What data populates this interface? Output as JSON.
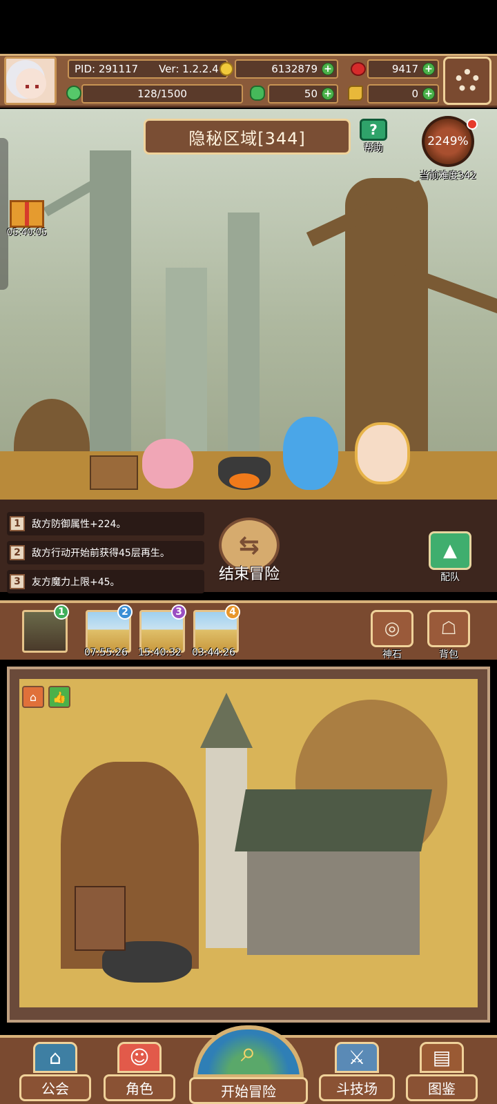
{
  "header": {
    "pid": "PID: 291117",
    "version": "Ver: 1.2.2.4",
    "gold": "6132879",
    "apples": "9417",
    "stamina": "128/1500",
    "clover": "50",
    "keys": "0"
  },
  "scene": {
    "region_title": "隐秘区域[344]",
    "help_label": "帮助",
    "difficulty_value": "2249%",
    "difficulty_label": "当前难度342",
    "gift_timer": "05:40:05"
  },
  "buffs": [
    {
      "num": "1",
      "text": "敌方防御属性+224。"
    },
    {
      "num": "2",
      "text": "敌方行动开始前获得45层再生。"
    },
    {
      "num": "3",
      "text": "友方魔力上限+45。"
    }
  ],
  "actions": {
    "end_adventure": "结束冒险",
    "team": "配队"
  },
  "stages": [
    {
      "badge": "1",
      "timer": "",
      "color": "#3fae5a"
    },
    {
      "badge": "2",
      "timer": "07:55:26",
      "color": "#3a8fd6"
    },
    {
      "badge": "3",
      "timer": "15:40:32",
      "color": "#9a4fc2"
    },
    {
      "badge": "4",
      "timer": "03:44:26",
      "color": "#e8962a"
    }
  ],
  "side_buttons": {
    "god_stone": "神石",
    "backpack": "背包"
  },
  "nav": {
    "guild": "公会",
    "character": "角色",
    "start": "开始冒险",
    "arena": "斗技场",
    "codex": "图鉴"
  }
}
